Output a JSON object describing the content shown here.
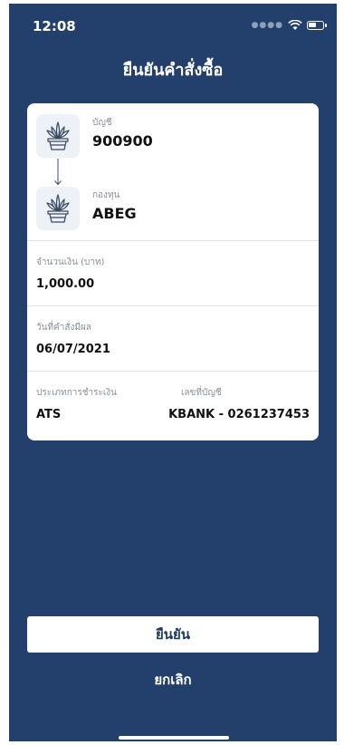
{
  "status": {
    "time": "12:08"
  },
  "header": {
    "title": "ยืนยันคำสั่งซื้อ"
  },
  "order": {
    "account_label": "บัญชี",
    "account_value": "900900",
    "fund_label": "กองทุน",
    "fund_value": "ABEG",
    "amount_label": "จำนวนเงิน (บาท)",
    "amount_value": "1,000.00",
    "effective_date_label": "วันที่คำสั่งมีผล",
    "effective_date_value": "06/07/2021",
    "payment_type_label": "ประเภทการชำระเงิน",
    "payment_type_value": "ATS",
    "bank_account_label": "เลขที่บัญชี",
    "bank_account_value": "KBANK - 0261237453"
  },
  "icons": [
    "plant-pot-icon",
    "arrow-down-icon",
    "wifi-icon",
    "battery-icon"
  ],
  "actions": {
    "confirm_label": "ยืนยัน",
    "cancel_label": "ยกเลิก"
  },
  "colors": {
    "background": "#233f6b",
    "card": "#ffffff",
    "confirm_text": "#1f3a63"
  }
}
